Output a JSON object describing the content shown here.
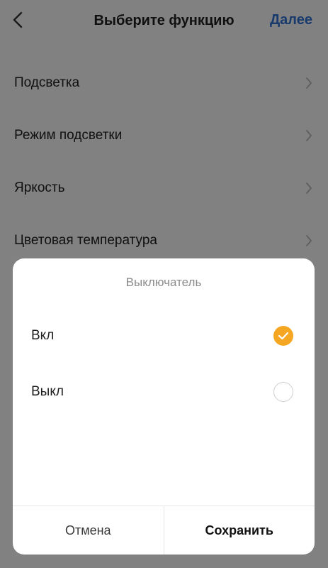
{
  "header": {
    "title": "Выберите функцию",
    "next_label": "Далее",
    "back_icon": "chevron-left-icon"
  },
  "menu": {
    "items": [
      {
        "label": "Подсветка"
      },
      {
        "label": "Режим подсветки"
      },
      {
        "label": "Яркость"
      },
      {
        "label": "Цветовая температура"
      }
    ]
  },
  "dialog": {
    "title": "Выключатель",
    "options": [
      {
        "label": "Вкл",
        "selected": true
      },
      {
        "label": "Выкл",
        "selected": false
      }
    ],
    "cancel_label": "Отмена",
    "save_label": "Сохранить",
    "accent_color": "#f5a623"
  }
}
